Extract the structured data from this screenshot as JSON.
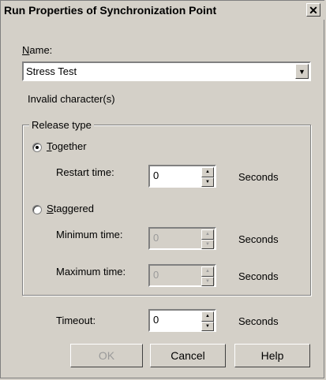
{
  "dialog": {
    "title": "Run Properties of Synchronization Point",
    "close_glyph": "✕"
  },
  "name": {
    "label_access": "N",
    "label_rest": "ame:",
    "value": "Stress Test",
    "error_text": "Invalid character(s)"
  },
  "release_type": {
    "legend": "Release type",
    "together": {
      "label_access": "T",
      "label_rest": "ogether",
      "selected": true
    },
    "restart": {
      "label": "Restart time:",
      "value": "0",
      "unit": "Seconds"
    },
    "staggered": {
      "label_access": "S",
      "label_rest": "taggered",
      "selected": false
    },
    "minimum": {
      "label": "Minimum time:",
      "value": "0",
      "unit": "Seconds",
      "enabled": false
    },
    "maximum": {
      "label": "Maximum time:",
      "value": "0",
      "unit": "Seconds",
      "enabled": false
    }
  },
  "timeout": {
    "label": "Timeout:",
    "value": "0",
    "unit": "Seconds"
  },
  "buttons": {
    "ok": "OK",
    "cancel": "Cancel",
    "help": "Help"
  },
  "icons": {
    "spin_up": "▲",
    "spin_down": "▼",
    "dropdown": "▼"
  }
}
